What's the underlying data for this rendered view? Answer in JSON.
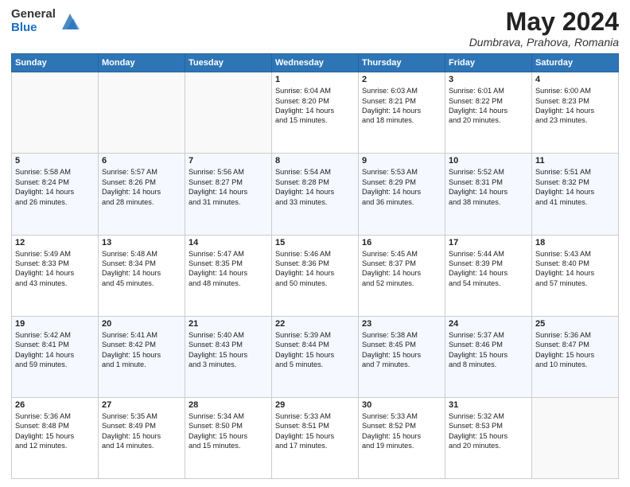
{
  "header": {
    "logo_general": "General",
    "logo_blue": "Blue",
    "title": "May 2024",
    "location": "Dumbrava, Prahova, Romania"
  },
  "columns": [
    "Sunday",
    "Monday",
    "Tuesday",
    "Wednesday",
    "Thursday",
    "Friday",
    "Saturday"
  ],
  "weeks": [
    [
      {
        "day": "",
        "text": ""
      },
      {
        "day": "",
        "text": ""
      },
      {
        "day": "",
        "text": ""
      },
      {
        "day": "1",
        "text": "Sunrise: 6:04 AM\nSunset: 8:20 PM\nDaylight: 14 hours\nand 15 minutes."
      },
      {
        "day": "2",
        "text": "Sunrise: 6:03 AM\nSunset: 8:21 PM\nDaylight: 14 hours\nand 18 minutes."
      },
      {
        "day": "3",
        "text": "Sunrise: 6:01 AM\nSunset: 8:22 PM\nDaylight: 14 hours\nand 20 minutes."
      },
      {
        "day": "4",
        "text": "Sunrise: 6:00 AM\nSunset: 8:23 PM\nDaylight: 14 hours\nand 23 minutes."
      }
    ],
    [
      {
        "day": "5",
        "text": "Sunrise: 5:58 AM\nSunset: 8:24 PM\nDaylight: 14 hours\nand 26 minutes."
      },
      {
        "day": "6",
        "text": "Sunrise: 5:57 AM\nSunset: 8:26 PM\nDaylight: 14 hours\nand 28 minutes."
      },
      {
        "day": "7",
        "text": "Sunrise: 5:56 AM\nSunset: 8:27 PM\nDaylight: 14 hours\nand 31 minutes."
      },
      {
        "day": "8",
        "text": "Sunrise: 5:54 AM\nSunset: 8:28 PM\nDaylight: 14 hours\nand 33 minutes."
      },
      {
        "day": "9",
        "text": "Sunrise: 5:53 AM\nSunset: 8:29 PM\nDaylight: 14 hours\nand 36 minutes."
      },
      {
        "day": "10",
        "text": "Sunrise: 5:52 AM\nSunset: 8:31 PM\nDaylight: 14 hours\nand 38 minutes."
      },
      {
        "day": "11",
        "text": "Sunrise: 5:51 AM\nSunset: 8:32 PM\nDaylight: 14 hours\nand 41 minutes."
      }
    ],
    [
      {
        "day": "12",
        "text": "Sunrise: 5:49 AM\nSunset: 8:33 PM\nDaylight: 14 hours\nand 43 minutes."
      },
      {
        "day": "13",
        "text": "Sunrise: 5:48 AM\nSunset: 8:34 PM\nDaylight: 14 hours\nand 45 minutes."
      },
      {
        "day": "14",
        "text": "Sunrise: 5:47 AM\nSunset: 8:35 PM\nDaylight: 14 hours\nand 48 minutes."
      },
      {
        "day": "15",
        "text": "Sunrise: 5:46 AM\nSunset: 8:36 PM\nDaylight: 14 hours\nand 50 minutes."
      },
      {
        "day": "16",
        "text": "Sunrise: 5:45 AM\nSunset: 8:37 PM\nDaylight: 14 hours\nand 52 minutes."
      },
      {
        "day": "17",
        "text": "Sunrise: 5:44 AM\nSunset: 8:39 PM\nDaylight: 14 hours\nand 54 minutes."
      },
      {
        "day": "18",
        "text": "Sunrise: 5:43 AM\nSunset: 8:40 PM\nDaylight: 14 hours\nand 57 minutes."
      }
    ],
    [
      {
        "day": "19",
        "text": "Sunrise: 5:42 AM\nSunset: 8:41 PM\nDaylight: 14 hours\nand 59 minutes."
      },
      {
        "day": "20",
        "text": "Sunrise: 5:41 AM\nSunset: 8:42 PM\nDaylight: 15 hours\nand 1 minute."
      },
      {
        "day": "21",
        "text": "Sunrise: 5:40 AM\nSunset: 8:43 PM\nDaylight: 15 hours\nand 3 minutes."
      },
      {
        "day": "22",
        "text": "Sunrise: 5:39 AM\nSunset: 8:44 PM\nDaylight: 15 hours\nand 5 minutes."
      },
      {
        "day": "23",
        "text": "Sunrise: 5:38 AM\nSunset: 8:45 PM\nDaylight: 15 hours\nand 7 minutes."
      },
      {
        "day": "24",
        "text": "Sunrise: 5:37 AM\nSunset: 8:46 PM\nDaylight: 15 hours\nand 8 minutes."
      },
      {
        "day": "25",
        "text": "Sunrise: 5:36 AM\nSunset: 8:47 PM\nDaylight: 15 hours\nand 10 minutes."
      }
    ],
    [
      {
        "day": "26",
        "text": "Sunrise: 5:36 AM\nSunset: 8:48 PM\nDaylight: 15 hours\nand 12 minutes."
      },
      {
        "day": "27",
        "text": "Sunrise: 5:35 AM\nSunset: 8:49 PM\nDaylight: 15 hours\nand 14 minutes."
      },
      {
        "day": "28",
        "text": "Sunrise: 5:34 AM\nSunset: 8:50 PM\nDaylight: 15 hours\nand 15 minutes."
      },
      {
        "day": "29",
        "text": "Sunrise: 5:33 AM\nSunset: 8:51 PM\nDaylight: 15 hours\nand 17 minutes."
      },
      {
        "day": "30",
        "text": "Sunrise: 5:33 AM\nSunset: 8:52 PM\nDaylight: 15 hours\nand 19 minutes."
      },
      {
        "day": "31",
        "text": "Sunrise: 5:32 AM\nSunset: 8:53 PM\nDaylight: 15 hours\nand 20 minutes."
      },
      {
        "day": "",
        "text": ""
      }
    ]
  ]
}
